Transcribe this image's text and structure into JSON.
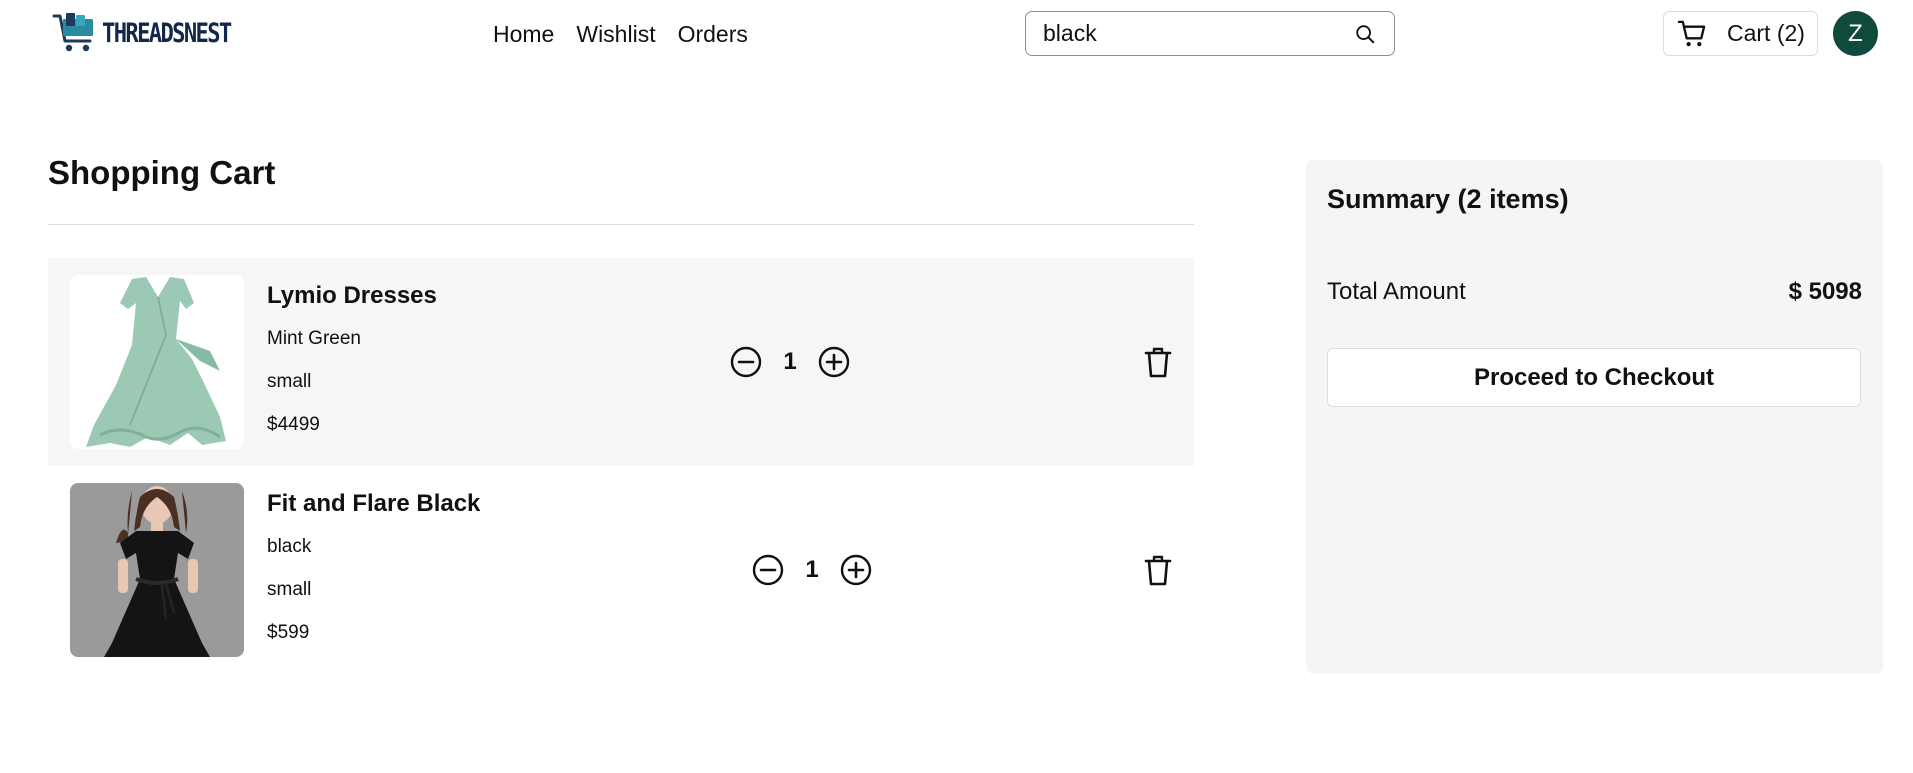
{
  "brand": {
    "logo_text": "THREADSNEST",
    "accent_color": "#0f4a3c"
  },
  "nav": {
    "items": [
      "Home",
      "Wishlist",
      "Orders"
    ]
  },
  "search": {
    "value": "black",
    "icon": "search-icon"
  },
  "header": {
    "cart_label": "Cart (2)",
    "avatar_initial": "Z"
  },
  "cart": {
    "title": "Shopping Cart",
    "items": [
      {
        "name": "Lymio Dresses",
        "color": "Mint Green",
        "size": "small",
        "price": "$4499",
        "quantity": "1",
        "image": "mint-green-wrap-dress"
      },
      {
        "name": "Fit and Flare Black",
        "color": "black",
        "size": "small",
        "price": "$599",
        "quantity": "1",
        "image": "black-fit-and-flare-dress"
      }
    ]
  },
  "summary": {
    "title": "Summary (2 items)",
    "total_label": "Total Amount",
    "total_value": "$ 5098",
    "checkout_label": "Proceed to Checkout"
  }
}
